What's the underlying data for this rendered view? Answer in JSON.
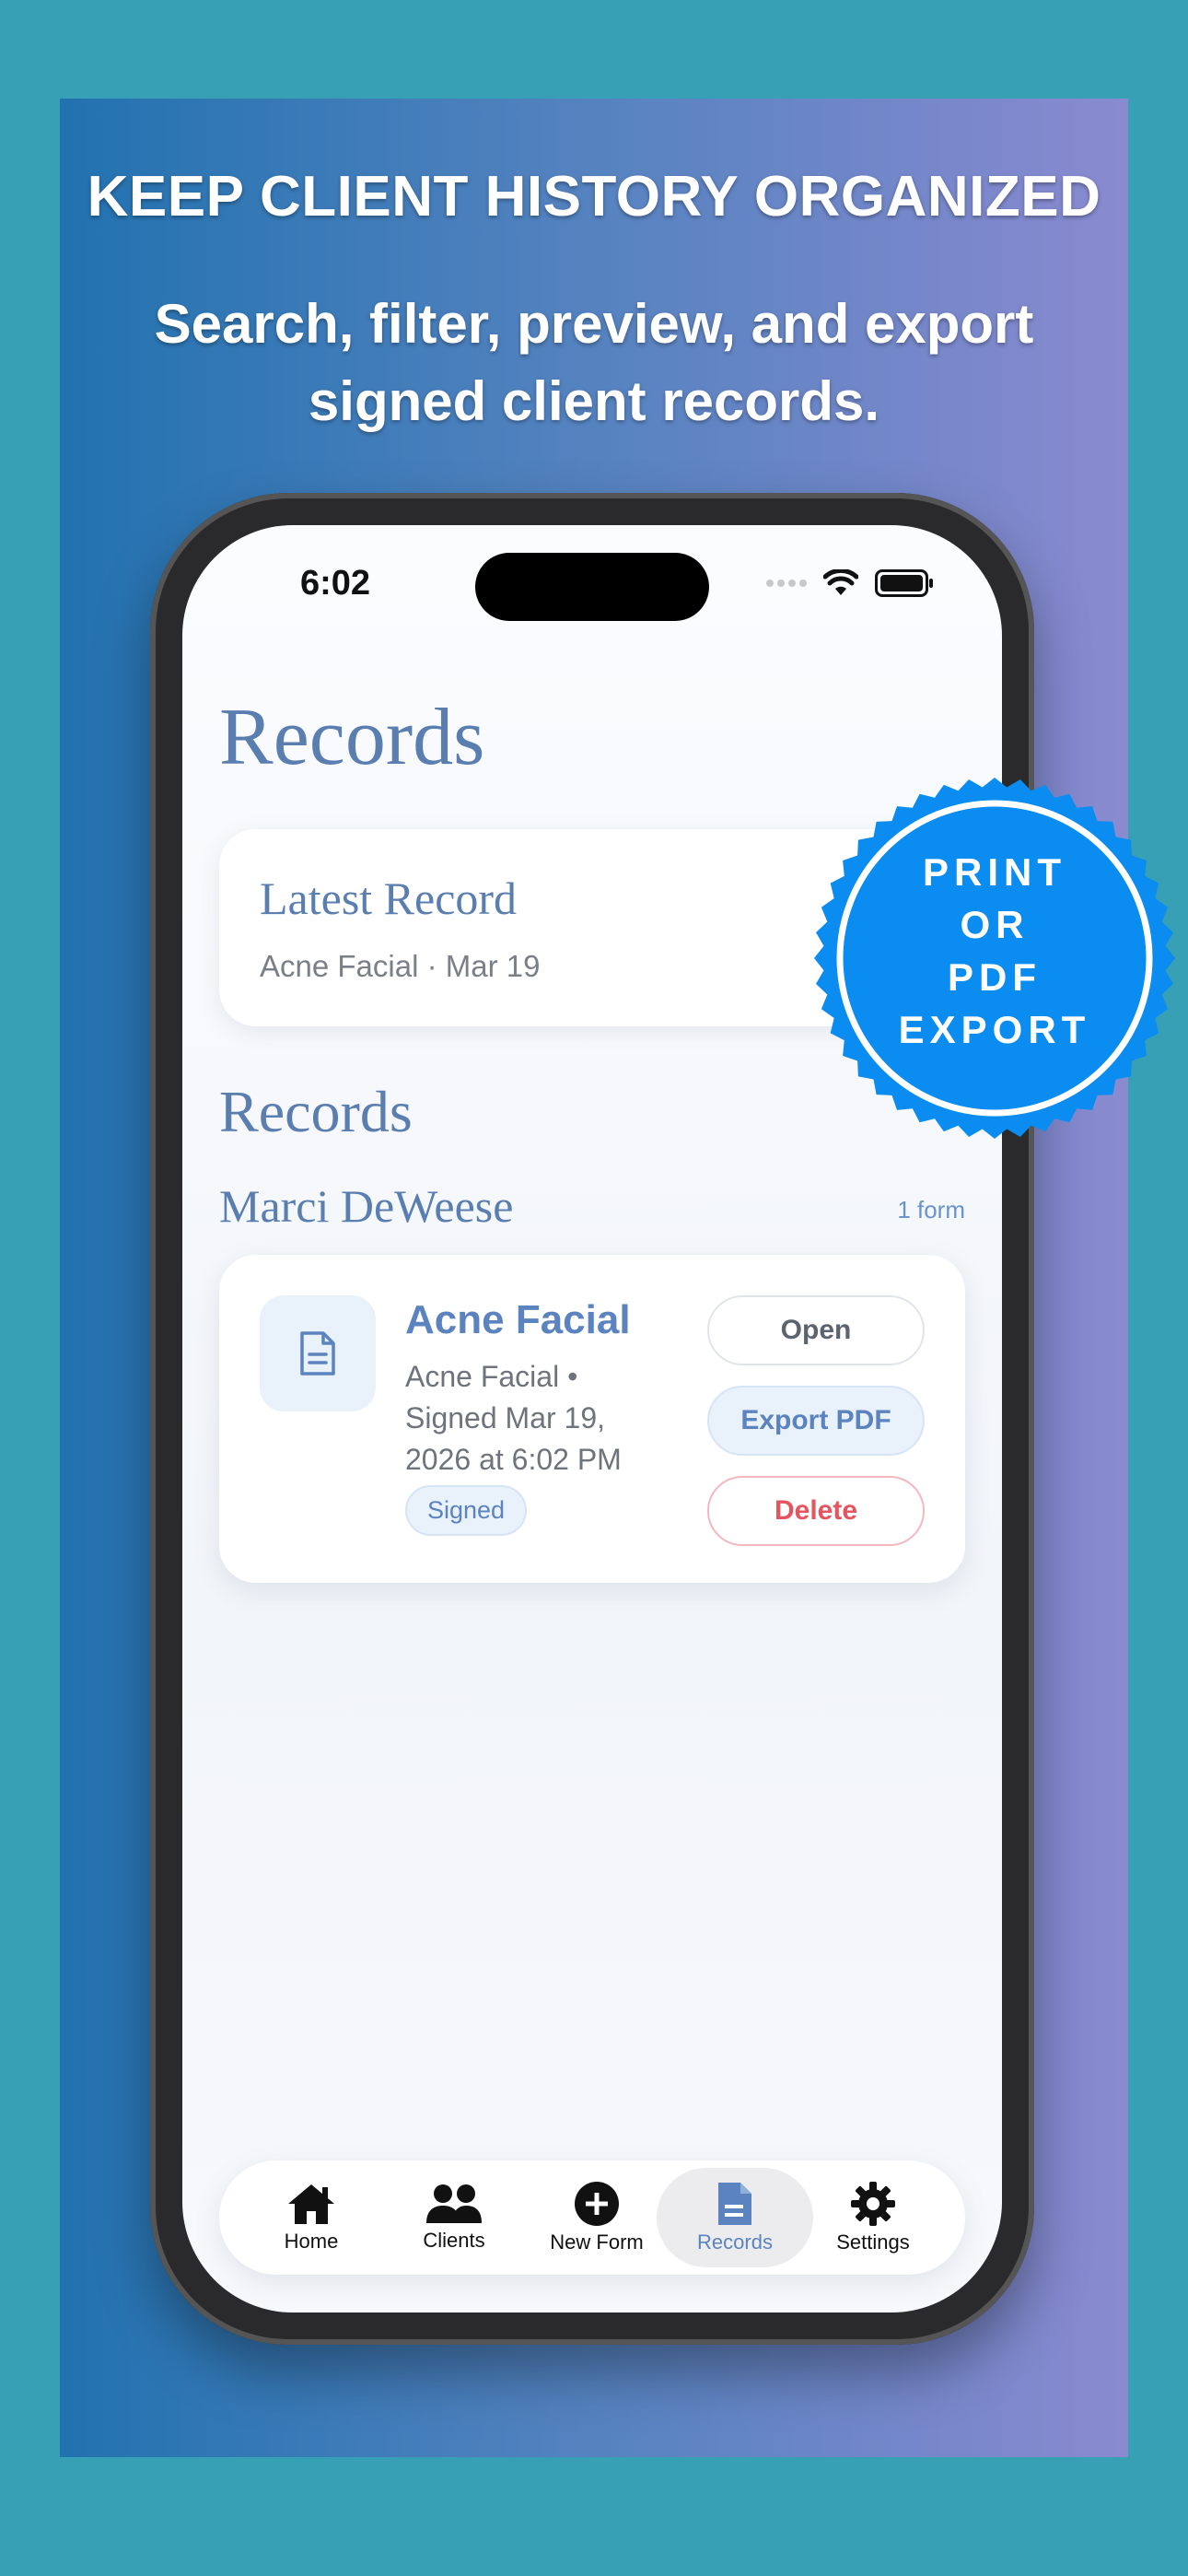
{
  "headline": "KEEP CLIENT HISTORY ORGANIZED",
  "subhead": "Search, filter, preview, and export signed client records.",
  "status_bar": {
    "time": "6:02"
  },
  "page": {
    "title": "Records",
    "latest": {
      "title": "Latest Record",
      "subtitle": "Acne Facial · Mar 19"
    },
    "section_title": "Records",
    "group": {
      "client_name": "Marci DeWeese",
      "count": "1 form"
    },
    "record": {
      "title": "Acne Facial",
      "description": "Acne Facial • Signed Mar 19, 2026 at 6:02 PM",
      "status": "Signed",
      "open_label": "Open",
      "export_label": "Export PDF",
      "delete_label": "Delete"
    }
  },
  "tabbar": {
    "items": [
      {
        "label": "Home",
        "icon": "home-icon"
      },
      {
        "label": "Clients",
        "icon": "people-icon"
      },
      {
        "label": "New Form",
        "icon": "plus-circle-icon"
      },
      {
        "label": "Records",
        "icon": "document-icon",
        "active": true
      },
      {
        "label": "Settings",
        "icon": "gear-icon"
      }
    ]
  },
  "seal": {
    "lines": [
      "PRINT",
      "OR",
      "PDF",
      "EXPORT"
    ],
    "color": "#0b8cf0"
  },
  "colors": {
    "accent": "#5a83bf",
    "danger": "#e5545f",
    "background": "#37a0b4"
  }
}
